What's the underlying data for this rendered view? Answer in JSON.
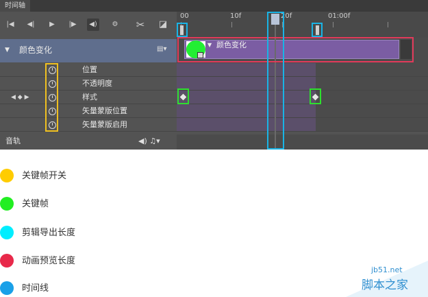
{
  "window": {
    "tab_label": "时间轴"
  },
  "ruler": {
    "labels": [
      "00",
      "10f",
      "20f",
      "01:00f"
    ]
  },
  "toolbar": {
    "first_frame_icon": "|◀",
    "prev_frame_icon": "◀|",
    "play_icon": "▶",
    "next_frame_icon": "|▶",
    "audio_icon": "◀)",
    "settings_icon": "⚙",
    "split_icon": "✂",
    "transition_icon": "◪"
  },
  "layer": {
    "name": "颜色变化",
    "clip_label": "颜色变化"
  },
  "properties": [
    {
      "label": "位置"
    },
    {
      "label": "不透明度"
    },
    {
      "label": "样式"
    },
    {
      "label": "矢量蒙版位置"
    },
    {
      "label": "矢量蒙版启用"
    }
  ],
  "keyframe_nav": "◀ ◆ ▶",
  "audio": {
    "label": "音轨",
    "icons": "◀) ♫▾"
  },
  "legend": [
    {
      "label": "关键帧开关",
      "color": "#ffcc00"
    },
    {
      "label": "关键帧",
      "color": "#22ee22"
    },
    {
      "label": "剪辑导出长度",
      "color": "#00eeff"
    },
    {
      "label": "动画预览长度",
      "color": "#e8294a"
    },
    {
      "label": "时间线",
      "color": "#1aa0e8"
    }
  ],
  "watermark": {
    "site": "jb51.net",
    "name": "脚本之家"
  }
}
